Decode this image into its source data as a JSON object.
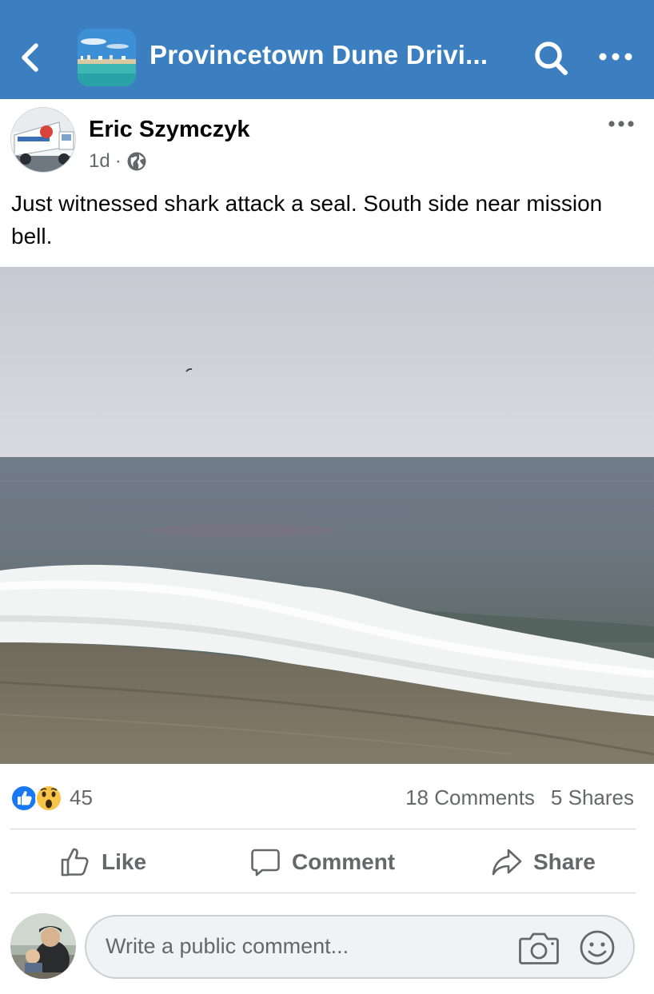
{
  "header": {
    "title": "Provincetown Dune Drivi...",
    "accent_color": "#3b7fc0",
    "back_icon": "chevron-left-icon",
    "search_icon": "search-icon",
    "more_icon": "more-horizontal-icon"
  },
  "post": {
    "author": "Eric Szymczyk",
    "time": "1d",
    "separator": "·",
    "audience_icon": "globe-icon",
    "text": "Just witnessed shark attack a seal. South side near mission bell."
  },
  "stats": {
    "reaction_icons": [
      "like-reaction-icon",
      "wow-reaction-icon"
    ],
    "reaction_count": "45",
    "comments": "18 Comments",
    "shares": "5 Shares"
  },
  "actions": {
    "like": "Like",
    "comment": "Comment",
    "share": "Share"
  },
  "composer": {
    "placeholder": "Write a public comment..."
  }
}
